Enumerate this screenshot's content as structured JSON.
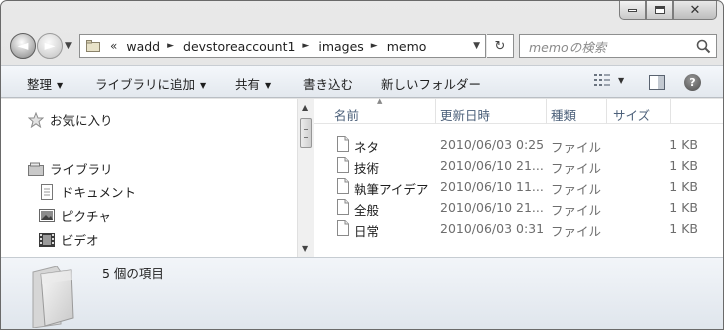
{
  "nav": {
    "back_glyph": "◄",
    "forward_glyph": "►",
    "breadcrumbs": [
      "wadd",
      "devstoreaccount1",
      "images",
      "memo"
    ],
    "overflow_glyph": "«",
    "refresh_glyph": "↻",
    "search_placeholder": "memoの検索"
  },
  "commands": {
    "organize": "整理",
    "add_to_library": "ライブラリに追加",
    "share": "共有",
    "burn": "書き込む",
    "new_folder": "新しいフォルダー",
    "help": "?"
  },
  "navpane": {
    "favorites": "お気に入り",
    "libraries": "ライブラリ",
    "documents": "ドキュメント",
    "pictures": "ピクチャ",
    "videos": "ビデオ"
  },
  "columns": {
    "name": "名前",
    "date": "更新日時",
    "type": "種類",
    "size": "サイズ"
  },
  "files": [
    {
      "name": "ネタ",
      "date": "2010/06/03 0:25",
      "type": "ファイル",
      "size": "1 KB"
    },
    {
      "name": "技術",
      "date": "2010/06/10 21...",
      "type": "ファイル",
      "size": "1 KB"
    },
    {
      "name": "執筆アイデア",
      "date": "2010/06/10 11...",
      "type": "ファイル",
      "size": "1 KB"
    },
    {
      "name": "全般",
      "date": "2010/06/10 21...",
      "type": "ファイル",
      "size": "1 KB"
    },
    {
      "name": "日常",
      "date": "2010/06/03 0:31",
      "type": "ファイル",
      "size": "1 KB"
    }
  ],
  "details": {
    "item_count": "5 個の項目"
  },
  "icons": {
    "caption": [
      "minimize-icon",
      "maximize-icon",
      "close-icon"
    ],
    "favorites": "star-icon",
    "libraries": "library-icon",
    "documents": "document-icon",
    "pictures": "picture-icon",
    "videos": "video-icon",
    "file": "file-icon"
  }
}
